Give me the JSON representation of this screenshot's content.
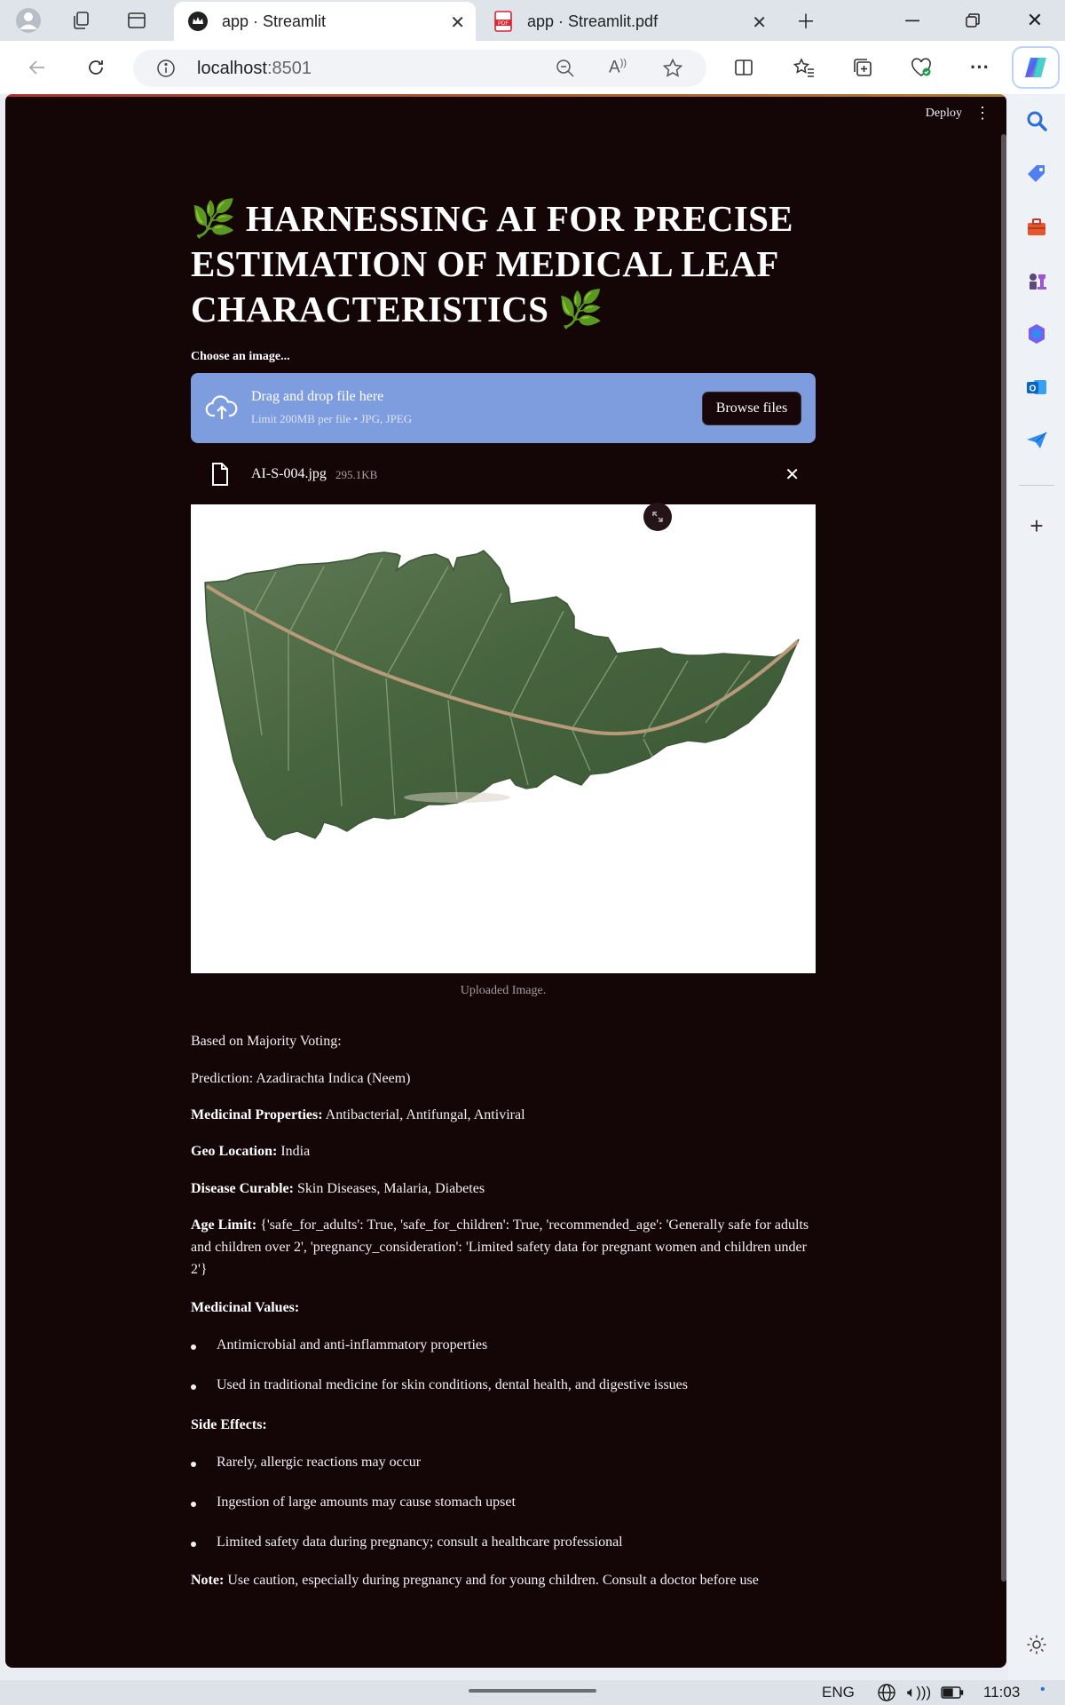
{
  "browser": {
    "tabs": [
      {
        "title": "app · Streamlit",
        "active": true
      },
      {
        "title": "app · Streamlit.pdf",
        "active": false
      }
    ],
    "url_host": "localhost",
    "url_port": ":8501"
  },
  "app": {
    "deploy_label": "Deploy",
    "title": "🌿 HARNESSING AI FOR PRECISE ESTIMATION OF MEDICAL LEAF CHARACTERISTICS 🌿",
    "uploader": {
      "label": "Choose an image...",
      "drag_text": "Drag and drop file here",
      "limit_text": "Limit 200MB per file • JPG, JPEG",
      "browse_label": "Browse files"
    },
    "file": {
      "name": "AI-S-004.jpg",
      "size": "295.1KB"
    },
    "image_caption": "Uploaded Image.",
    "results": {
      "majority": "Based on Majority Voting:",
      "prediction": "Prediction: Azadirachta Indica (Neem)",
      "medicinal_properties_label": "Medicinal Properties:",
      "medicinal_properties": " Antibacterial, Antifungal, Antiviral",
      "geo_label": "Geo Location:",
      "geo": " India",
      "disease_label": "Disease Curable:",
      "disease": " Skin Diseases, Malaria, Diabetes",
      "age_label": "Age Limit:",
      "age": " {'safe_for_adults': True, 'safe_for_children': True, 'recommended_age': 'Generally safe for adults and children over 2', 'pregnancy_consideration': 'Limited safety data for pregnant women and children under 2'}",
      "values_label": "Medicinal Values:",
      "values": [
        "Antimicrobial and anti-inflammatory properties",
        "Used in traditional medicine for skin conditions, dental health, and digestive issues"
      ],
      "side_label": "Side Effects:",
      "side_effects": [
        "Rarely, allergic reactions may occur",
        "Ingestion of large amounts may cause stomach upset",
        "Limited safety data during pregnancy; consult a healthcare professional"
      ],
      "note_label": "Note:",
      "note": " Use caution, especially during pregnancy and for young children. Consult a doctor before use"
    }
  },
  "taskbar": {
    "lang": "ENG",
    "time": "11:03"
  },
  "colors": {
    "page_bg": "#140506",
    "dropzone": "#7e9ddf",
    "browser_chrome": "#dfe3ea"
  }
}
